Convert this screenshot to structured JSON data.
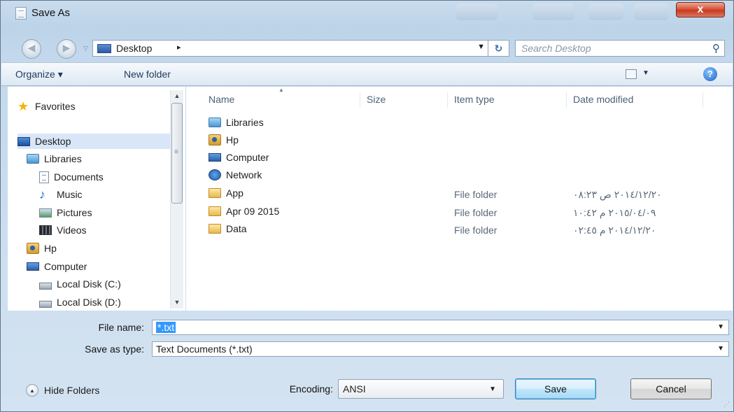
{
  "window": {
    "title": "Save As",
    "close_label": "x"
  },
  "address": {
    "crumb": "Desktop",
    "crumb_arrow": "▸",
    "refresh_glyph": "↻"
  },
  "search": {
    "placeholder": "Search Desktop"
  },
  "toolbar": {
    "organize": "Organize ▾",
    "new_folder": "New folder",
    "help": "?"
  },
  "nav": {
    "items": [
      {
        "label": "Favorites",
        "icon": "star-icon"
      },
      {
        "label": "Desktop",
        "icon": "desktop-icon"
      },
      {
        "label": "Libraries",
        "icon": "libraries-icon"
      },
      {
        "label": "Documents",
        "icon": "document-icon"
      },
      {
        "label": "Music",
        "icon": "music-icon"
      },
      {
        "label": "Pictures",
        "icon": "pictures-icon"
      },
      {
        "label": "Videos",
        "icon": "video-icon"
      },
      {
        "label": "Hp",
        "icon": "user-folder-icon"
      },
      {
        "label": "Computer",
        "icon": "computer-icon"
      },
      {
        "label": "Local Disk (C:)",
        "icon": "drive-c-icon"
      },
      {
        "label": "Local Disk (D:)",
        "icon": "drive-icon"
      }
    ]
  },
  "columns": {
    "name": "Name",
    "size": "Size",
    "type": "Item type",
    "date": "Date modified"
  },
  "files": [
    {
      "name": "Libraries",
      "icon": "libraries-icon",
      "type": "",
      "date": ""
    },
    {
      "name": "Hp",
      "icon": "user-folder-icon",
      "type": "",
      "date": ""
    },
    {
      "name": "Computer",
      "icon": "computer-icon",
      "type": "",
      "date": ""
    },
    {
      "name": "Network",
      "icon": "network-icon",
      "type": "",
      "date": ""
    },
    {
      "name": "App",
      "icon": "folder-icon",
      "type": "File folder",
      "date": "٢٠١٤/١٢/٢٠ ص ٠٨:٢٣"
    },
    {
      "name": "Apr 09 2015",
      "icon": "folder-icon",
      "type": "File folder",
      "date": "٢٠١٥/٠٤/٠٩ م ١٠:٤٢"
    },
    {
      "name": "Data",
      "icon": "folder-icon",
      "type": "File folder",
      "date": "٢٠١٤/١٢/٢٠ م ٠٢:٤٥"
    }
  ],
  "form": {
    "file_name_label": "File name:",
    "file_name_value": "*.txt",
    "save_type_label": "Save as type:",
    "save_type_value": "Text Documents (*.txt)",
    "encoding_label": "Encoding:",
    "encoding_value": "ANSI"
  },
  "footer": {
    "hide_folders": "Hide Folders",
    "save": "Save",
    "cancel": "Cancel"
  }
}
